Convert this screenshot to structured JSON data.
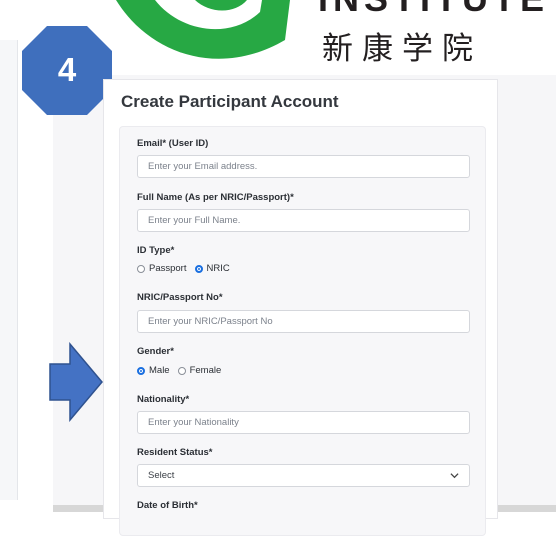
{
  "logo": {
    "en_text": "INSTITUTE",
    "cn_text": "新康学院"
  },
  "step_badge": {
    "number": "4",
    "color": "#3f6fbd"
  },
  "form": {
    "title": "Create Participant Account",
    "email": {
      "label": "Email* (User ID)",
      "placeholder": "Enter your Email address."
    },
    "full_name": {
      "label": "Full Name (As per NRIC/Passport)*",
      "placeholder": "Enter your Full Name."
    },
    "id_type": {
      "label": "ID Type*",
      "options": [
        "Passport",
        "NRIC"
      ],
      "selected": "NRIC"
    },
    "nric": {
      "label": "NRIC/Passport No*",
      "placeholder": "Enter your NRIC/Passport No"
    },
    "gender": {
      "label": "Gender*",
      "options": [
        "Male",
        "Female"
      ],
      "selected": "Male"
    },
    "nationality": {
      "label": "Nationality*",
      "placeholder": "Enter your Nationality"
    },
    "resident_status": {
      "label": "Resident Status*",
      "value": "Select"
    },
    "dob": {
      "label": "Date of Birth*"
    }
  },
  "colors": {
    "accent": "#1a6fe0",
    "logo_green": "#27a844",
    "annotation_blue": "#4472c4"
  }
}
